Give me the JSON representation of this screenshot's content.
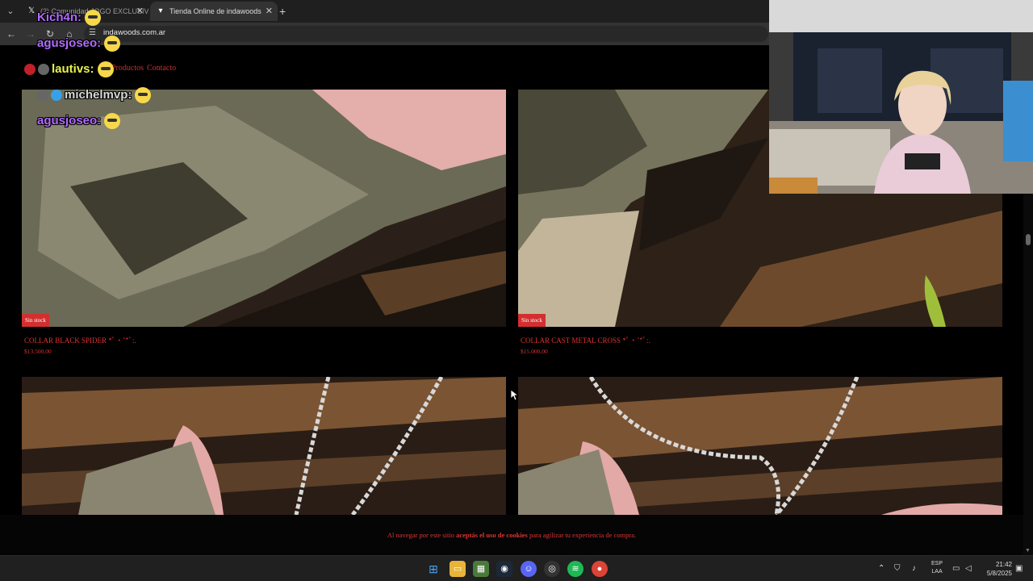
{
  "browser": {
    "tabs": [
      {
        "title": "(2) Comunidad JOGO EXCLUSIVO",
        "icon": "x-logo-icon",
        "active": false
      },
      {
        "title": "Tienda Online de indawoods",
        "icon": "site-favicon",
        "active": true
      }
    ],
    "url": "indawoods.com.ar"
  },
  "site_nav": {
    "items": [
      "Productos",
      "Contacto"
    ]
  },
  "products": [
    {
      "name": "COLLAR BLACK SPIDER *ﾟ‧˚*ﾟ:.",
      "price": "$13.500,00",
      "badge": "Sin stock"
    },
    {
      "name": "COLLAR CAST METAL CROSS *ﾟ‧˚*ﾟ:.",
      "price": "$15.000,00",
      "badge": "Sin stock"
    },
    {
      "name": "",
      "price": "",
      "badge": ""
    },
    {
      "name": "",
      "price": "",
      "badge": ""
    }
  ],
  "cookie_bar": {
    "prefix": "Al navegar por este sitio",
    "bold": "aceptás el uso de cookies",
    "suffix": "para agilizar tu experiencia de compra."
  },
  "stream_chat": [
    {
      "user": "Kich4n:",
      "color": "#b06bff"
    },
    {
      "user": "agusjoseo:",
      "color": "#b06bff"
    },
    {
      "user": "lautivs:",
      "color": "#e8f24a"
    },
    {
      "user": "michelmvp:",
      "color": "#d9d9d9"
    },
    {
      "user": "agusjoseo:",
      "color": "#b06bff"
    }
  ],
  "taskbar": {
    "apps": [
      "windows-start-icon",
      "file-explorer-icon",
      "app-icon",
      "steam-icon",
      "discord-icon",
      "obs-icon",
      "spotify-icon",
      "chrome-icon"
    ],
    "lang_top": "ESP",
    "lang_bottom": "LAA",
    "time": "21:42",
    "date": "5/8/2025"
  },
  "colors": {
    "accent": "#d33333",
    "badge": "#d32f2f",
    "page_bg": "#000000"
  }
}
